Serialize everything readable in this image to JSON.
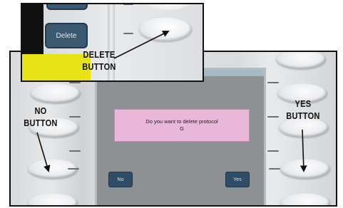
{
  "dialog": {
    "line1": "Do you want to delete protocol",
    "line2": "G"
  },
  "soft_buttons": {
    "no": "No",
    "yes": "Yes"
  },
  "inset": {
    "delete_button": "Delete"
  },
  "labels": {
    "delete_line1": "DELETE",
    "delete_line2": "BUTTON",
    "no_line1": "NO",
    "no_line2": "BUTTON",
    "yes_line1": "YES",
    "yes_line2": "BUTTON"
  },
  "colors": {
    "dialog_bg": "#e8b7d9",
    "soft_button_bg": "#2f4d66",
    "yellow_tab": "#e7e316"
  }
}
